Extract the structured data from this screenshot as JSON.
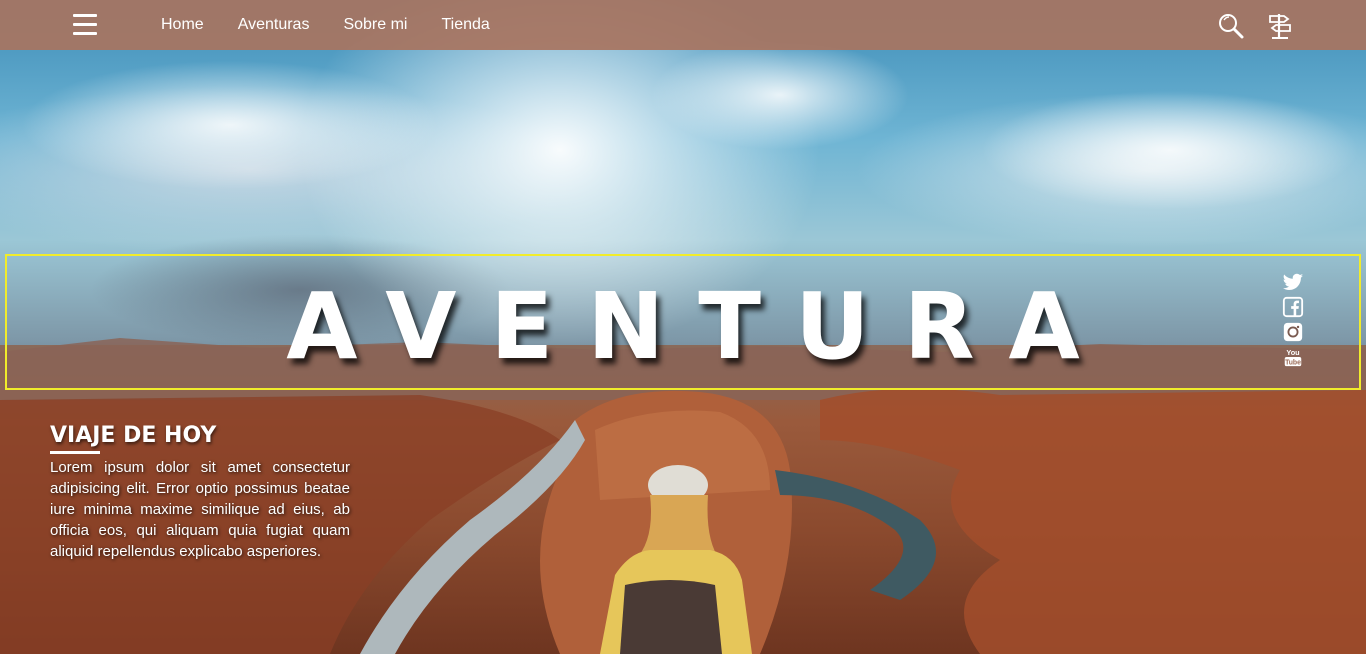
{
  "nav": {
    "menu_icon": "hamburger-icon",
    "links": [
      {
        "label": "Home"
      },
      {
        "label": "Aventuras"
      },
      {
        "label": "Sobre mi"
      },
      {
        "label": "Tienda"
      }
    ],
    "search_icon": "search-icon",
    "signpost_icon": "signpost-icon",
    "background_color": "#a87460"
  },
  "hero": {
    "title": "AVENTURA",
    "border_color": "#f1ec2b"
  },
  "social": [
    {
      "name": "twitter",
      "icon": "twitter-icon"
    },
    {
      "name": "facebook",
      "icon": "facebook-icon"
    },
    {
      "name": "instagram",
      "icon": "instagram-icon"
    },
    {
      "name": "youtube",
      "icon": "youtube-icon",
      "label_top": "You",
      "label_bottom": "Tube"
    }
  ],
  "article": {
    "heading": "VIAJE DE HOY",
    "body": "Lorem ipsum dolor sit amet consectetur adipisicing elit. Error optio possimus beatae iure minima maxime similique ad eius, ab officia eos, qui aliquam quia fugiat quam aliquid repellendus explicabo asperiores."
  }
}
